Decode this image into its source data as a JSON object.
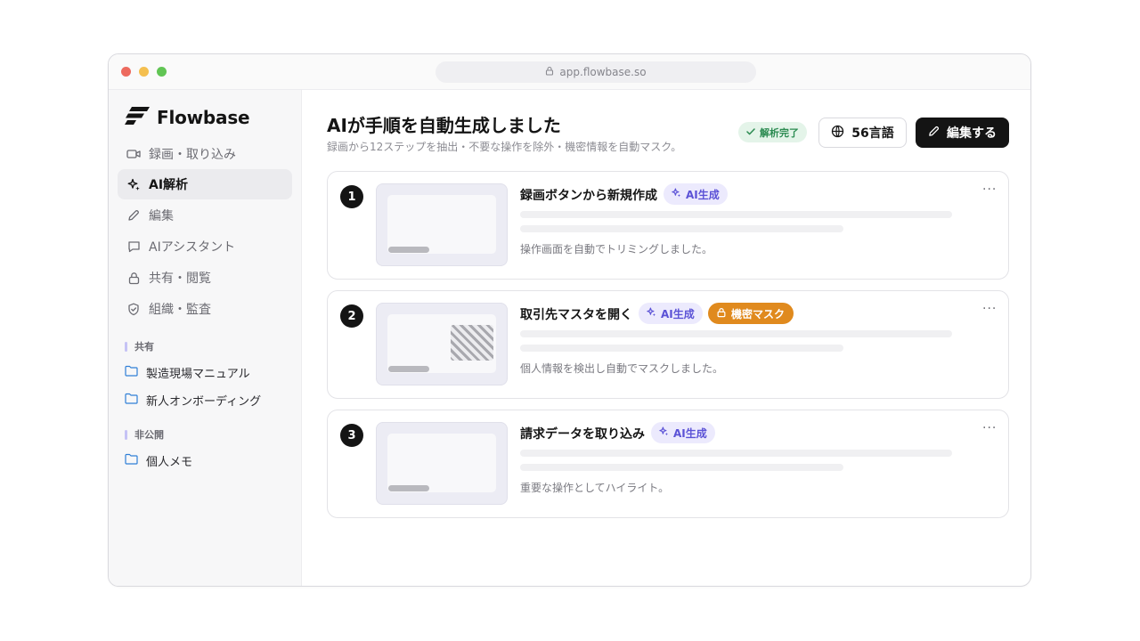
{
  "browser": {
    "url": "app.flowbase.so"
  },
  "brand": {
    "name": "Flowbase"
  },
  "sidebar": {
    "nav": [
      {
        "label": "録画・取り込み",
        "icon": "video-icon"
      },
      {
        "label": "AI解析",
        "icon": "sparkle-icon",
        "active": true
      },
      {
        "label": "編集",
        "icon": "pencil-icon"
      },
      {
        "label": "AIアシスタント",
        "icon": "chat-icon"
      },
      {
        "label": "共有・閲覧",
        "icon": "lock-icon"
      },
      {
        "label": "組織・監査",
        "icon": "shield-icon"
      }
    ],
    "shared_label": "共有",
    "shared_folders": [
      "製造現場マニュアル",
      "新人オンボーディング"
    ],
    "private_label": "非公開",
    "private_folders": [
      "個人メモ"
    ]
  },
  "header": {
    "title": "AIが手順を自動生成しました",
    "subtitle": "録画から12ステップを抽出・不要な操作を除外・機密情報を自動マスク。",
    "status_badge": "解析完了",
    "lang_button": "56言語",
    "edit_button": "編集する"
  },
  "steps": [
    {
      "number": "1",
      "title": "録画ボタンから新規作成",
      "ai_tag": "AI生成",
      "mask_tag": "",
      "description": "操作画面を自動でトリミングしました。",
      "more": "···"
    },
    {
      "number": "2",
      "title": "取引先マスタを開く",
      "ai_tag": "AI生成",
      "mask_tag": "機密マスク",
      "description": "個人情報を検出し自動でマスクしました。",
      "more": "···"
    },
    {
      "number": "3",
      "title": "請求データを取り込み",
      "ai_tag": "AI生成",
      "mask_tag": "",
      "description": "重要な操作としてハイライト。",
      "more": "···"
    }
  ],
  "colors": {
    "accent": "#5b52d6",
    "mask": "#e08a1e",
    "success": "#2a8a50",
    "dark": "#141414"
  }
}
